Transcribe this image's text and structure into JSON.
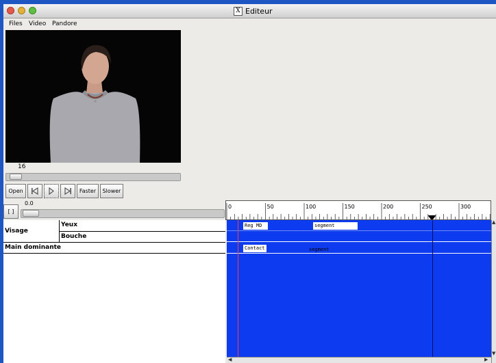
{
  "window": {
    "title": "Editeur"
  },
  "menu": {
    "items": [
      "Files",
      "Video",
      "Pandore"
    ]
  },
  "video": {
    "frame_number": "16",
    "slider_position": 0.02
  },
  "controls": {
    "open_label": "Open",
    "faster_label": "Faster",
    "slower_label": "Slower",
    "bracket_label": "[ ]",
    "cue_value": "0.0"
  },
  "ruler": {
    "labels": [
      "0",
      "50",
      "100",
      "150",
      "200",
      "250",
      "300"
    ],
    "playhead": 265
  },
  "tracks": {
    "group_visage": "Visage",
    "yeux": "Yeux",
    "bouche": "Bouche",
    "main_dominante": "Main dominante"
  },
  "segments": {
    "yeux_1": "Reg MD",
    "yeux_2": "segment",
    "main_1": "Contact",
    "main_2": "segment"
  },
  "colors": {
    "timeline": "#0d3cf0",
    "desktop": "#1e56c4",
    "cursor": "#ff3b3b"
  }
}
